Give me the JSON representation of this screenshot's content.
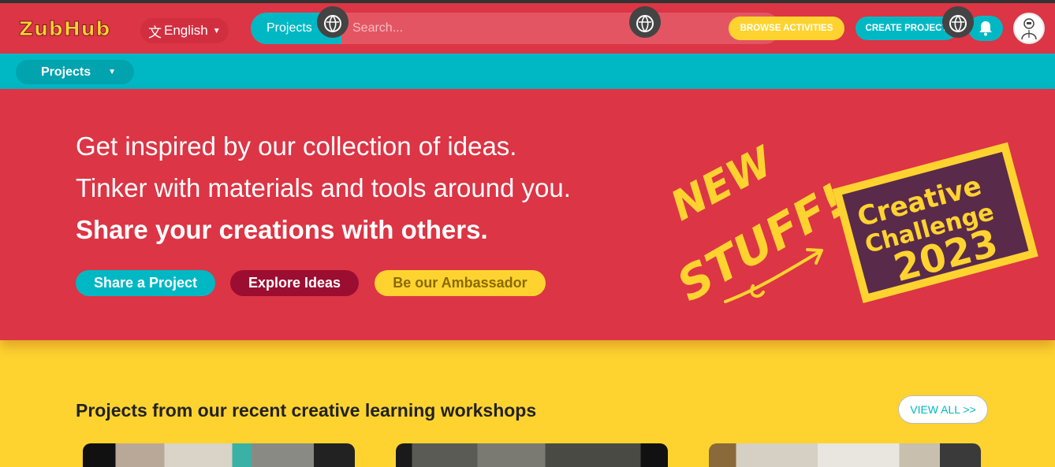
{
  "header": {
    "logo": "ZubHub",
    "language": "English",
    "search": {
      "type": "Projects",
      "placeholder": "Search..."
    },
    "browse_activities": "BROWSE ACTIVITIES",
    "create_project": "CREATE PROJECT"
  },
  "subnav": {
    "projects": "Projects"
  },
  "hero": {
    "line1": "Get inspired by our collection of ideas.",
    "line2": "Tinker with materials and tools around you.",
    "line3": "Share your creations with others.",
    "buttons": {
      "share": "Share a Project",
      "explore": "Explore Ideas",
      "ambassador": "Be our Ambassador"
    },
    "promo": {
      "new": "NEW",
      "stuff": "STUFF!",
      "challenge_line1": "Creative",
      "challenge_line2": "Challenge",
      "challenge_year": "2023"
    }
  },
  "section": {
    "title": "Projects from our recent creative learning workshops",
    "view_all": "VIEW ALL >>"
  },
  "colors": {
    "red": "#DC3545",
    "teal": "#00B8C4",
    "yellow": "#FED330",
    "maroon": "#9c0d32"
  },
  "icons": [
    "translate-icon",
    "caret-down-icon",
    "bell-icon",
    "avatar-icon",
    "globe-icon",
    "arrow-icon"
  ]
}
